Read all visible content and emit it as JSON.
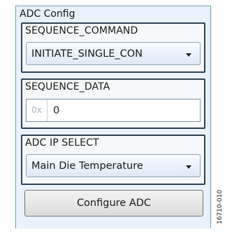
{
  "panel": {
    "title": "ADC Config"
  },
  "sequence_command": {
    "label": "SEQUENCE_COMMAND",
    "selected": "INITIATE_SINGLE_CON"
  },
  "sequence_data": {
    "label": "SEQUENCE_DATA",
    "prefix": "0x",
    "value": "0"
  },
  "adc_ip_select": {
    "label": "ADC IP SELECT",
    "selected": "Main Die Temperature"
  },
  "configure_button": {
    "label": "Configure ADC"
  },
  "figure_id": "16710-010"
}
